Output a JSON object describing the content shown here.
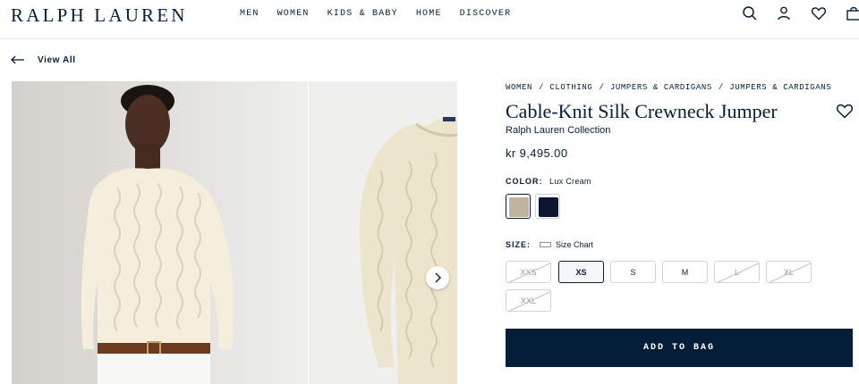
{
  "header": {
    "logo": "RALPH LAUREN",
    "nav": [
      "MEN",
      "WOMEN",
      "KIDS & BABY",
      "HOME",
      "DISCOVER"
    ],
    "icons": [
      "search-icon",
      "account-icon",
      "heart-icon",
      "bag-icon"
    ]
  },
  "back": {
    "label": "View All",
    "icon": "arrow-left-icon"
  },
  "breadcrumb": [
    "WOMEN",
    "CLOTHING",
    "JUMPERS & CARDIGANS",
    "JUMPERS & CARDIGANS"
  ],
  "product": {
    "title": "Cable-Knit Silk Crewneck Jumper",
    "brand": "Ralph Lauren Collection",
    "price": "kr 9,495.00"
  },
  "color": {
    "label": "COLOR:",
    "selected": "Lux Cream",
    "swatches": [
      {
        "name": "Lux Cream",
        "hex": "#bfb3a0",
        "selected": true
      },
      {
        "name": "Navy",
        "hex": "#0b1730",
        "selected": false
      }
    ]
  },
  "size": {
    "label": "SIZE:",
    "chart_label": "Size Chart",
    "options": [
      {
        "label": "XXS",
        "available": false,
        "selected": false
      },
      {
        "label": "XS",
        "available": true,
        "selected": true
      },
      {
        "label": "S",
        "available": true,
        "selected": false
      },
      {
        "label": "M",
        "available": true,
        "selected": false
      },
      {
        "label": "L",
        "available": false,
        "selected": false
      },
      {
        "label": "XL",
        "available": false,
        "selected": false
      },
      {
        "label": "XXL",
        "available": false,
        "selected": false
      }
    ]
  },
  "cta": {
    "add_to_bag": "ADD TO BAG"
  },
  "colors": {
    "brand_navy": "#041e3a",
    "border": "#cfd4da"
  }
}
